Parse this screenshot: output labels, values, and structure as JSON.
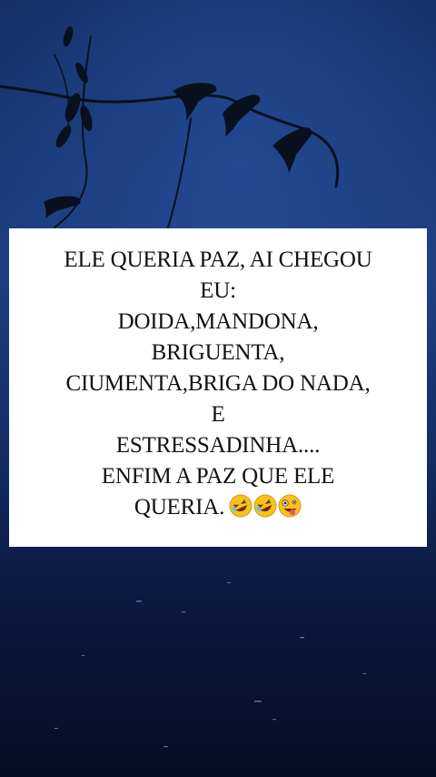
{
  "meme": {
    "lines": [
      "ELE QUERIA PAZ, AI CHEGOU",
      "EU:",
      "DOIDA,MANDONA,",
      "BRIGUENTA,",
      "CIUMENTA,BRIGA DO NADA,",
      "E",
      "ESTRESSADINHA....",
      "ENFIM A PAZ QUE ELE",
      "QUERIA."
    ],
    "emojis": [
      "rolling-on-floor-laughing",
      "rolling-on-floor-laughing",
      "zany-face"
    ]
  },
  "colors": {
    "sky_top": "#1a3a78",
    "sky_bottom": "#0a1638",
    "water": "#071026",
    "silhouette": "#08101e",
    "emoji_yellow": "#f8c21c"
  }
}
